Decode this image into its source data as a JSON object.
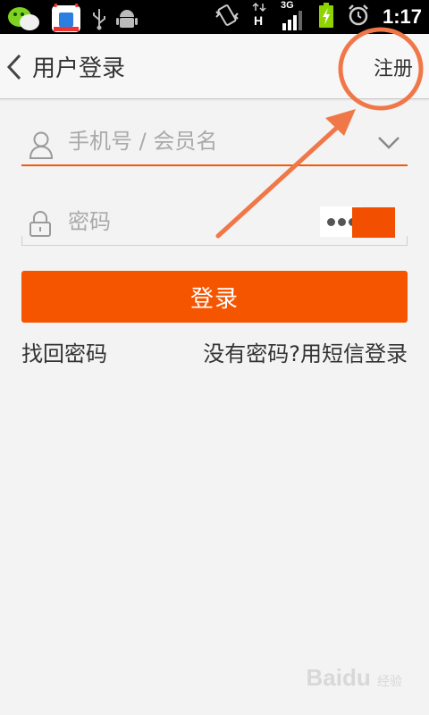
{
  "status_bar": {
    "network_type": "3G",
    "time": "1:17"
  },
  "header": {
    "title": "用户登录",
    "register_label": "注册"
  },
  "form": {
    "username_placeholder": "手机号 / 会员名",
    "password_placeholder": "密码",
    "login_label": "登录",
    "forgot_password_label": "找回密码",
    "sms_login_label": "没有密码?用短信登录"
  },
  "watermark": {
    "text": "Baidu",
    "subtext": "经验"
  },
  "colors": {
    "accent": "#f65500",
    "annotation": "#f07848"
  }
}
